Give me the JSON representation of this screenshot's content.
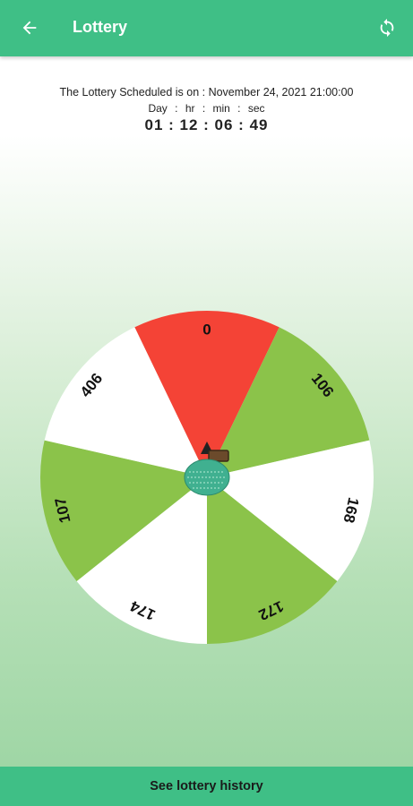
{
  "appbar": {
    "title": "Lottery",
    "back_icon": "arrow-left-icon",
    "refresh_icon": "refresh-icon",
    "color": "#3fbf86"
  },
  "schedule": {
    "text": "The Lottery Scheduled is on : November 24, 2021  21:00:00",
    "units": [
      "Day",
      "hr",
      "min",
      "sec"
    ],
    "countdown": "01 : 12 : 06 : 49"
  },
  "wheel": {
    "segments": [
      {
        "label": "0",
        "color": "#f44336"
      },
      {
        "label": "106",
        "color": "#8bc34a"
      },
      {
        "label": "168",
        "color": "#ffffff"
      },
      {
        "label": "172",
        "color": "#8bc34a"
      },
      {
        "label": "174",
        "color": "#ffffff"
      },
      {
        "label": "107",
        "color": "#8bc34a"
      },
      {
        "label": "406",
        "color": "#ffffff"
      }
    ],
    "pointer_icon": "pointer-arrow-icon",
    "center_icon": "money-bag-icon"
  },
  "footer": {
    "history_label": "See lottery history"
  }
}
